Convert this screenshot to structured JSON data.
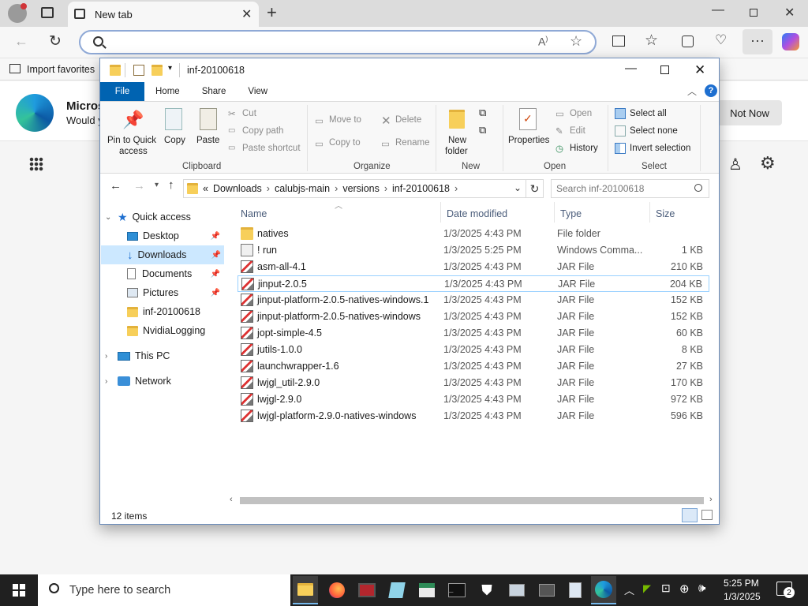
{
  "browser": {
    "tab_title": "New tab",
    "address_value": "",
    "favorites_import": "Import favorites",
    "promo_title": "Micros",
    "promo_sub": "Would y",
    "not_now": "Not Now"
  },
  "explorer": {
    "title": "inf-20100618",
    "ribbon_tabs": [
      "File",
      "Home",
      "Share",
      "View"
    ],
    "clipboard": {
      "pin": "Pin to Quick",
      "pin2": "access",
      "copy": "Copy",
      "paste": "Paste",
      "cut": "Cut",
      "copy_path": "Copy path",
      "paste_shortcut": "Paste shortcut",
      "label": "Clipboard"
    },
    "organize": {
      "move_to": "Move to",
      "copy_to": "Copy to",
      "delete": "Delete",
      "rename": "Rename",
      "label": "Organize"
    },
    "new": {
      "new_folder": "New",
      "new_folder2": "folder",
      "label": "New"
    },
    "open": {
      "properties": "Properties",
      "open": "Open",
      "edit": "Edit",
      "history": "History",
      "label": "Open"
    },
    "select": {
      "select_all": "Select all",
      "select_none": "Select none",
      "invert": "Invert selection",
      "label": "Select"
    },
    "path": {
      "prefix": "«",
      "segments": [
        "Downloads",
        "calubjs-main",
        "versions",
        "inf-20100618"
      ]
    },
    "search_placeholder": "Search inf-20100618",
    "nav": {
      "quick_access": "Quick access",
      "items": [
        {
          "label": "Desktop",
          "pinned": true
        },
        {
          "label": "Downloads",
          "pinned": true
        },
        {
          "label": "Documents",
          "pinned": true
        },
        {
          "label": "Pictures",
          "pinned": true
        },
        {
          "label": "inf-20100618",
          "pinned": false
        },
        {
          "label": "NvidiaLogging",
          "pinned": false
        }
      ],
      "this_pc": "This PC",
      "network": "Network"
    },
    "columns": {
      "name": "Name",
      "date": "Date modified",
      "type": "Type",
      "size": "Size"
    },
    "files": [
      {
        "name": "natives",
        "date": "1/3/2025 4:43 PM",
        "type": "File folder",
        "size": "",
        "icon": "folder-icon"
      },
      {
        "name": "! run",
        "date": "1/3/2025 5:25 PM",
        "type": "Windows Comma...",
        "size": "1 KB",
        "icon": "batch-file-icon"
      },
      {
        "name": "asm-all-4.1",
        "date": "1/3/2025 4:43 PM",
        "type": "JAR File",
        "size": "210 KB",
        "icon": "jar-file-icon"
      },
      {
        "name": "jinput-2.0.5",
        "date": "1/3/2025 4:43 PM",
        "type": "JAR File",
        "size": "204 KB",
        "icon": "jar-file-icon"
      },
      {
        "name": "jinput-platform-2.0.5-natives-windows.1",
        "date": "1/3/2025 4:43 PM",
        "type": "JAR File",
        "size": "152 KB",
        "icon": "jar-file-icon"
      },
      {
        "name": "jinput-platform-2.0.5-natives-windows",
        "date": "1/3/2025 4:43 PM",
        "type": "JAR File",
        "size": "152 KB",
        "icon": "jar-file-icon"
      },
      {
        "name": "jopt-simple-4.5",
        "date": "1/3/2025 4:43 PM",
        "type": "JAR File",
        "size": "60 KB",
        "icon": "jar-file-icon"
      },
      {
        "name": "jutils-1.0.0",
        "date": "1/3/2025 4:43 PM",
        "type": "JAR File",
        "size": "8 KB",
        "icon": "jar-file-icon"
      },
      {
        "name": "launchwrapper-1.6",
        "date": "1/3/2025 4:43 PM",
        "type": "JAR File",
        "size": "27 KB",
        "icon": "jar-file-icon"
      },
      {
        "name": "lwjgl_util-2.9.0",
        "date": "1/3/2025 4:43 PM",
        "type": "JAR File",
        "size": "170 KB",
        "icon": "jar-file-icon"
      },
      {
        "name": "lwjgl-2.9.0",
        "date": "1/3/2025 4:43 PM",
        "type": "JAR File",
        "size": "972 KB",
        "icon": "jar-file-icon"
      },
      {
        "name": "lwjgl-platform-2.9.0-natives-windows",
        "date": "1/3/2025 4:43 PM",
        "type": "JAR File",
        "size": "596 KB",
        "icon": "jar-file-icon"
      }
    ],
    "status": "12 items"
  },
  "taskbar": {
    "search_placeholder": "Type here to search",
    "time": "5:25 PM",
    "date": "1/3/2025",
    "notifications": "2"
  },
  "colors": {
    "accent": "#0063b1",
    "selection": "#cce8ff",
    "hover": "#e5f3ff"
  }
}
